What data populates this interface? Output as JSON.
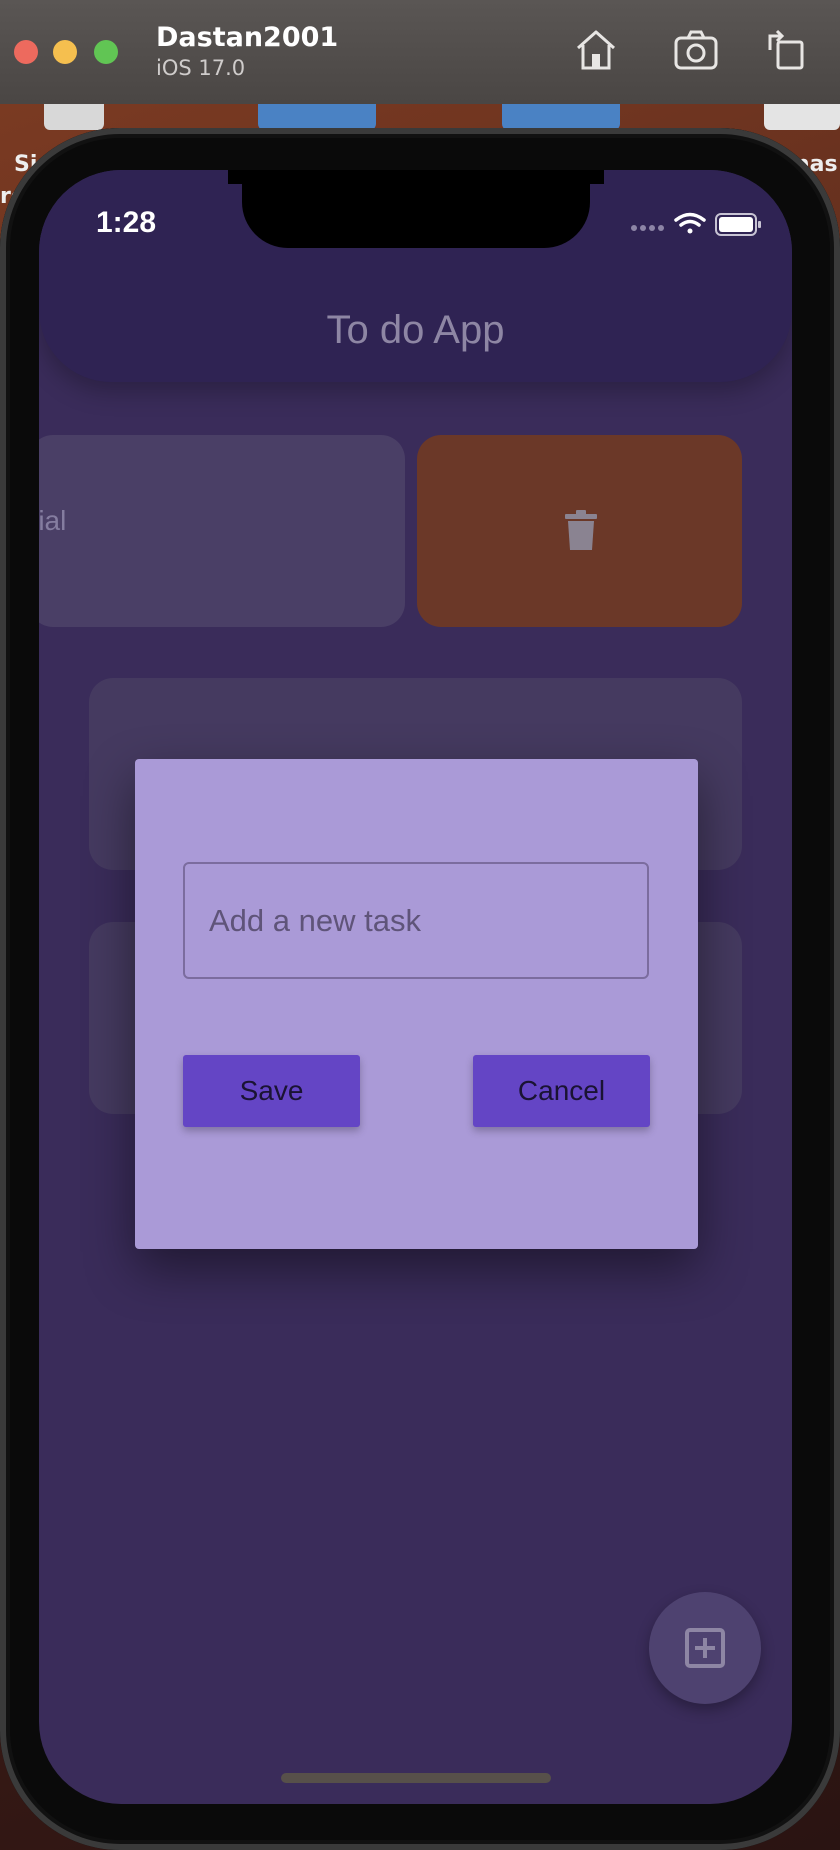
{
  "window": {
    "device_name": "Dastan2001",
    "os_version": "iOS 17.0",
    "toolbar_icons": [
      "home-icon",
      "screenshot-icon",
      "rotate-icon"
    ]
  },
  "desktop": {
    "left_fragment": "Si",
    "left_fragment_2": "re",
    "right_fragment": "nas"
  },
  "status_bar": {
    "time": "1:28",
    "icons": [
      "cellular-dots-icon",
      "wifi-icon",
      "battery-icon"
    ]
  },
  "app": {
    "title": "To do App",
    "tasks": [
      {
        "text_fragment": "rial",
        "swiped_open": true
      },
      {
        "text_fragment": ""
      },
      {
        "text_fragment": ""
      }
    ],
    "delete_action_icon": "trash-icon",
    "fab_icon": "add-box-icon"
  },
  "dialog": {
    "input_placeholder": "Add a new task",
    "input_value": "",
    "save_label": "Save",
    "cancel_label": "Cancel"
  },
  "colors": {
    "screen_bg": "#3a2c5a",
    "appbar_bg": "#2f2353",
    "dialog_bg": "#aa9ad7",
    "button_bg": "#6445c5",
    "delete_bg": "#6b3828"
  }
}
